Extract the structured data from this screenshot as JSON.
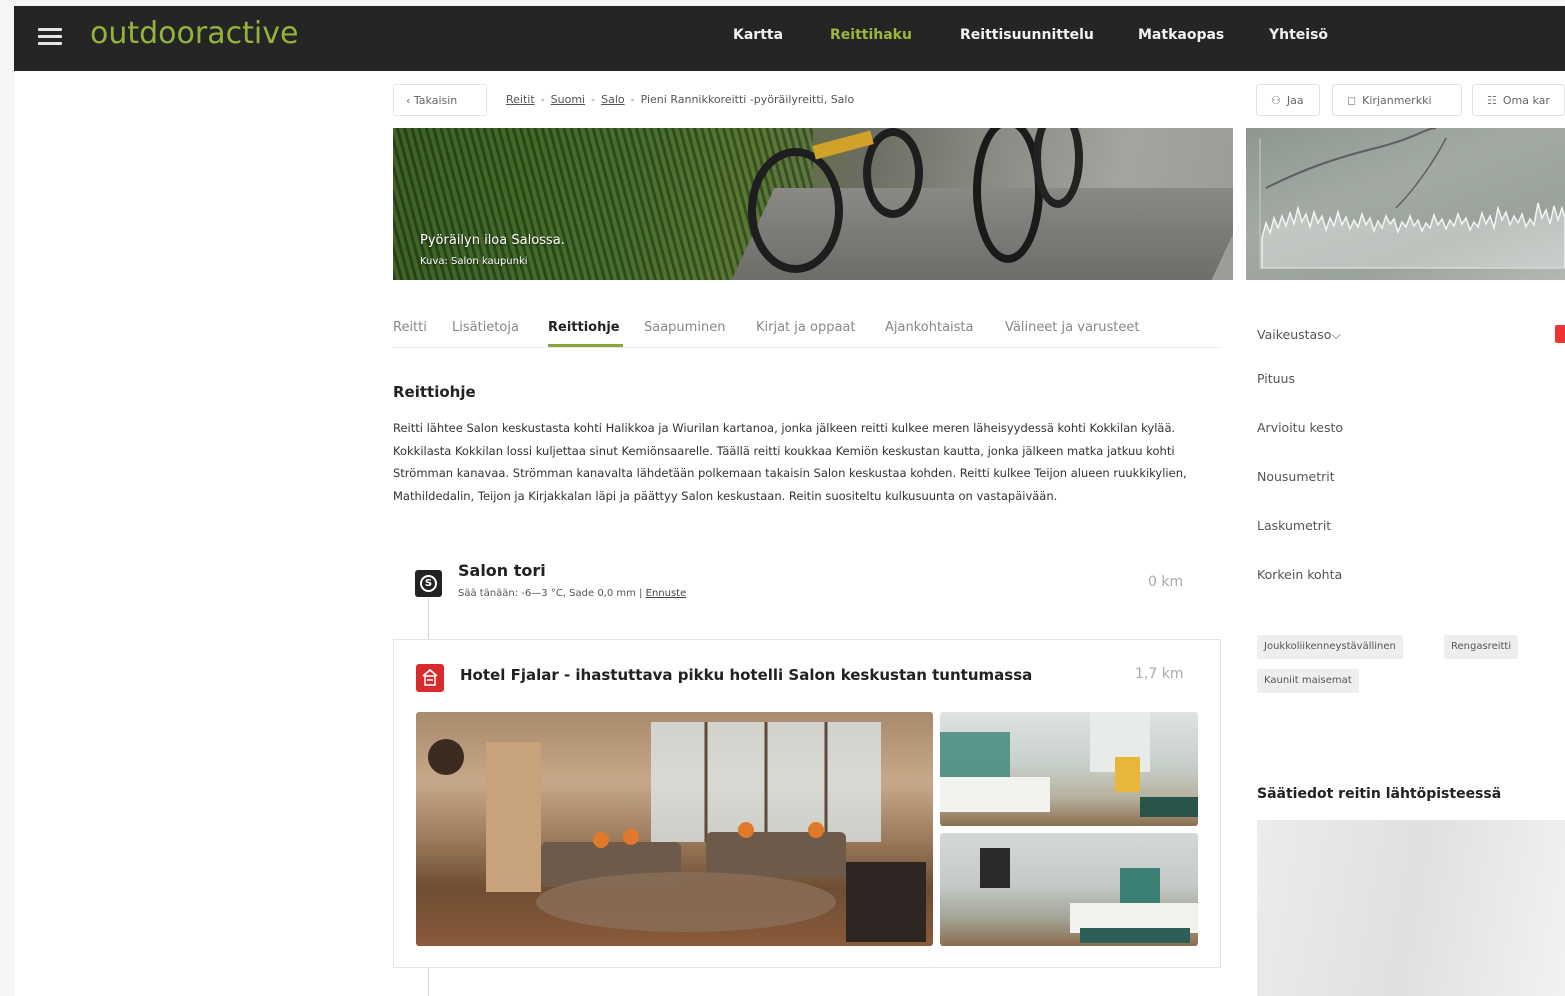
{
  "app": {
    "logo": "outdooractive"
  },
  "nav": {
    "items": [
      {
        "label": "Kartta"
      },
      {
        "label": "Reittihaku"
      },
      {
        "label": "Reittisuunnittelu"
      },
      {
        "label": "Matkaopas"
      },
      {
        "label": "Yhteisö"
      }
    ],
    "active_color": "#9ab83a"
  },
  "breadcrumb": {
    "back_label": "‹ Takaisin",
    "items": [
      "Reitit",
      "Suomi",
      "Salo"
    ],
    "current": "Pieni Rannikkoreitti -pyöräilyreitti, Salo"
  },
  "actions": {
    "share_label": "Jaa",
    "bookmark_label": "Kirjanmerkki",
    "own_label": "Oma kar"
  },
  "hero": {
    "caption": "Pyöräilyn iloa Salossa.",
    "credit": "Kuva: Salon kaupunki"
  },
  "tabs": [
    {
      "label": "Reitti"
    },
    {
      "label": "Lisätietoja"
    },
    {
      "label": "Reittiohje"
    },
    {
      "label": "Saapuminen"
    },
    {
      "label": "Kirjat ja oppaat"
    },
    {
      "label": "Ajankohtaista"
    },
    {
      "label": "Välineet ja varusteet"
    }
  ],
  "active_tab": "Reittiohje",
  "content": {
    "title": "Reittiohje",
    "description": "Reitti lähtee Salon keskustasta kohti Halikkoa ja Wiurilan kartanoa, jonka jälkeen reitti kulkee meren läheisyydessä kohti Kokkilan kylää. Kokkilasta Kokkilan lossi kuljettaa sinut Kemiönsaarelle. Täällä reitti koukkaa Kemiön keskustan kautta, jonka jälkeen matka jatkuu kohti Strömman kanavaa. Strömman kanavalta lähdetään polkemaan takaisin Salon keskustaa kohden. Reitti kulkee Teijon alueen ruukkikylien, Mathildedalin, Teijon ja Kirjakkalan läpi ja päättyy Salon keskustaan. Reitin suositeltu kulkusuunta on vastapäivään."
  },
  "stop": {
    "icon_letter": "S",
    "name": "Salon tori",
    "weather_text": "Sää tänään: -6—3 °C, Sade 0,0 mm |",
    "forecast_link": "Ennuste",
    "distance": "0 km"
  },
  "poi": {
    "title": "Hotel Fjalar - ihastuttava pikku hotelli Salon keskustan tuntumassa",
    "distance": "1,7 km",
    "icon_color": "#d92b2b"
  },
  "sidebar": {
    "facts": [
      {
        "label": "Vaikeustaso⌵"
      },
      {
        "label": "Pituus"
      },
      {
        "label": "Arvioitu kesto"
      },
      {
        "label": "Nousumetrit"
      },
      {
        "label": "Laskumetrit"
      },
      {
        "label": "Korkein kohta"
      }
    ],
    "tags": [
      "Joukkoliikenneystävällinen",
      "Rengasreitti",
      "Kauniit maisemat"
    ],
    "weather_title": "Säätiedot reitin lähtöpisteessä"
  },
  "colors": {
    "nav_bg": "#252525",
    "accent": "#8aa63a",
    "poi_red": "#d92b2b"
  }
}
